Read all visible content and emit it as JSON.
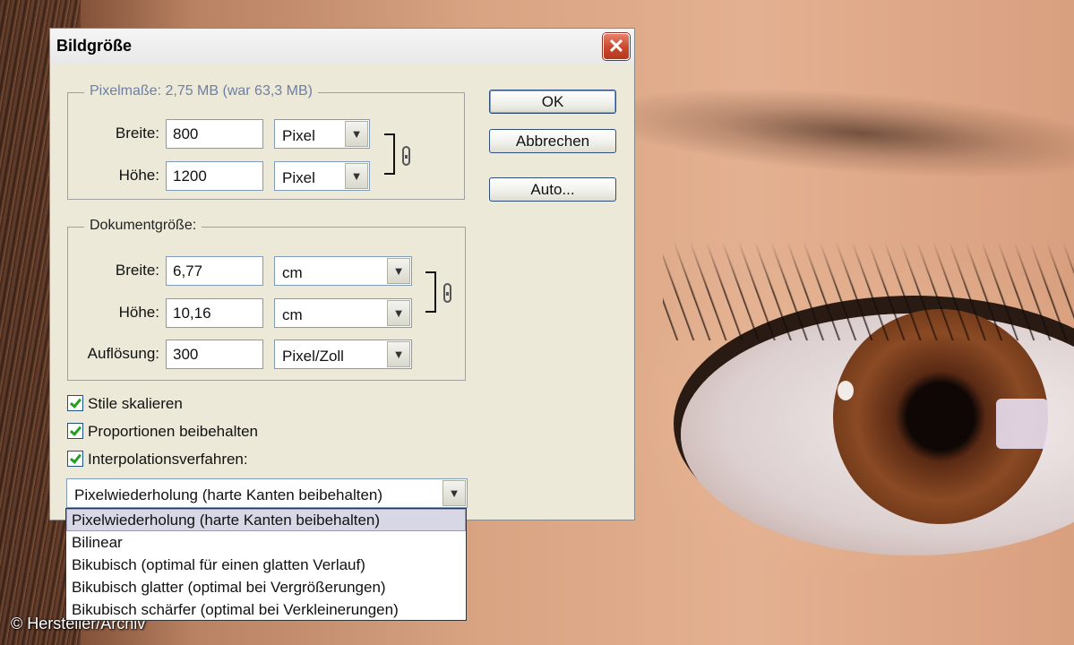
{
  "dialog": {
    "title": "Bildgröße",
    "close_glyph": "✕"
  },
  "pixel_dims": {
    "legend": "Pixelmaße: 2,75 MB (war 63,3 MB)",
    "width_label": "Breite:",
    "width_value": "800",
    "width_unit": "Pixel",
    "height_label": "Höhe:",
    "height_value": "1200",
    "height_unit": "Pixel"
  },
  "doc_size": {
    "legend": "Dokumentgröße:",
    "width_label": "Breite:",
    "width_value": "6,77",
    "width_unit": "cm",
    "height_label": "Höhe:",
    "height_value": "10,16",
    "height_unit": "cm",
    "resolution_label": "Auflösung:",
    "resolution_value": "300",
    "resolution_unit": "Pixel/Zoll"
  },
  "buttons": {
    "ok": "OK",
    "cancel": "Abbrechen",
    "auto": "Auto..."
  },
  "checkboxes": {
    "scale_styles": "Stile skalieren",
    "constrain_proportions": "Proportionen beibehalten",
    "resample": "Interpolationsverfahren:"
  },
  "interpolation": {
    "selected": "Pixelwiederholung (harte Kanten beibehalten)",
    "options": [
      "Pixelwiederholung (harte Kanten beibehalten)",
      "Bilinear",
      "Bikubisch (optimal für einen glatten Verlauf)",
      "Bikubisch glatter (optimal bei Vergrößerungen)",
      "Bikubisch schärfer (optimal bei Verkleinerungen)"
    ]
  },
  "icons": {
    "dropdown_arrow": "chevron-down-icon",
    "chain": "chain-link-icon",
    "close": "close-icon",
    "check": "checkmark-icon"
  },
  "colors": {
    "dialog_bg": "#ece9d8",
    "close_button": "#c8472c",
    "legend_pixel": "#6e7fa5"
  },
  "credit": "© Hersteller/Archiv"
}
